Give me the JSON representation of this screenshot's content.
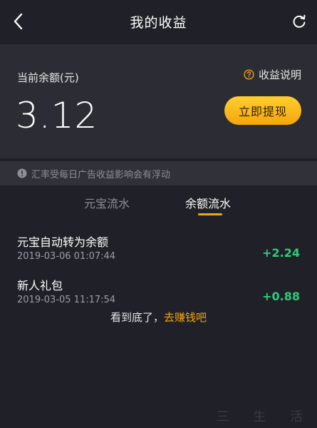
{
  "nav": {
    "title": "我的收益",
    "back_icon": "chevron-left-icon",
    "refresh_icon": "refresh-icon"
  },
  "balance": {
    "label": "当前余额(元)",
    "value": "3.12",
    "explain_label": "收益说明",
    "withdraw_label": "立即提现"
  },
  "notice": {
    "text": "汇率受每日广告收益影响会有浮动"
  },
  "tabs": [
    {
      "label": "元宝流水",
      "active": false
    },
    {
      "label": "余额流水",
      "active": true
    }
  ],
  "records": [
    {
      "title": "元宝自动转为余额",
      "time": "2019-03-06 01:07:44",
      "amount": "+2.24"
    },
    {
      "title": "新人礼包",
      "time": "2019-03-05 11:17:54",
      "amount": "+0.88"
    }
  ],
  "footer": {
    "end_text": "看到底了，",
    "link_text": "去赚钱吧"
  },
  "watermark": "三 生 活",
  "colors": {
    "background": "#202128",
    "card": "#2c2d34",
    "accent": "#f6a50c",
    "positive": "#2ecc77",
    "muted": "#8e8f96"
  }
}
